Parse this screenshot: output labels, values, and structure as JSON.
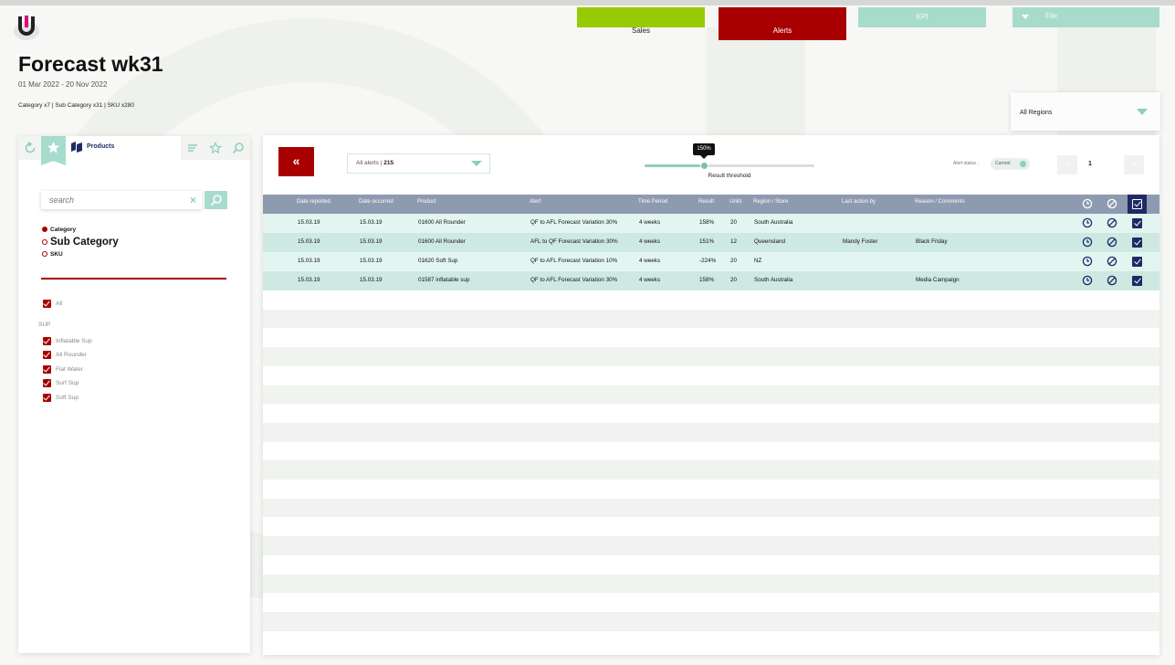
{
  "page": {
    "title": "Forecast wk31",
    "date_range": "01 Mar 2022 - 20 Nov 2022",
    "counts": "Category x7  |  Sub Category x31  |  SKU x280"
  },
  "top_tabs": {
    "sales": "Sales",
    "alerts": "Alerts",
    "kpi": "KPI",
    "file": "File"
  },
  "region": {
    "selected": "All Regions"
  },
  "sidebar": {
    "products_tab": "Products",
    "search_placeholder": "search",
    "levels": [
      "Category",
      "Sub Category",
      "SKU"
    ],
    "all_label": "All",
    "group_label": "SUP",
    "items": [
      "Inflatable Sup",
      "All Rounder",
      "Flat Water",
      "Surf Sup",
      "Soft Sup"
    ]
  },
  "toolbar": {
    "back_label": "«",
    "alerts_filter_label": "All alerts",
    "alerts_filter_sep": " | ",
    "alerts_filter_count": "215",
    "threshold_value": "150%",
    "threshold_fraction": 0.35,
    "threshold_label": "Result threshold",
    "alert_status_label": "Alert status :",
    "alert_status_value": "Current",
    "page_number": "1",
    "prev_label": "‹",
    "next_label": "›"
  },
  "table": {
    "columns": [
      "Date reported",
      "Date occurred",
      "Product",
      "Alert",
      "Time Period",
      "Result",
      "Units",
      "Region / Store",
      "Last action by",
      "Reason / Comments"
    ],
    "rows": [
      {
        "date_reported": "15.03.19",
        "date_occurred": "15.03.19",
        "product": "01600 All Rounder",
        "alert": "QF to AFL Forecast Variation 30%",
        "period": "4 weeks",
        "result": "158%",
        "units": "20",
        "region": "South Australia",
        "last_action": "",
        "reason": ""
      },
      {
        "date_reported": "15.03.19",
        "date_occurred": "15.03.19",
        "product": "01600 All Rounder",
        "alert": "AFL to QF Forecast Variation 30%",
        "period": "4 weeks",
        "result": "151%",
        "units": "12",
        "region": "Queensland",
        "last_action": "Mandy Foster",
        "reason": "Black Friday"
      },
      {
        "date_reported": "15.03.19",
        "date_occurred": "15.03.19",
        "product": "01620 Soft Sup",
        "alert": "QF to AFL Forecast Variation 10%",
        "period": "4 weeks",
        "result": "-224%",
        "units": "20",
        "region": "NZ",
        "last_action": "",
        "reason": ""
      },
      {
        "date_reported": "15.03.19",
        "date_occurred": "15.03.19",
        "product": "01587 inflatable sup",
        "alert": "QF to AFL Forecast Variation 30%",
        "period": "4 weeks",
        "result": "158%",
        "units": "20",
        "region": "South Australia",
        "last_action": "",
        "reason": "Media Campaign"
      }
    ]
  },
  "colors": {
    "accent_red": "#a80000",
    "accent_mint": "#a7dccd",
    "accent_green": "#95cb00",
    "navy": "#1e2a66",
    "header_gray": "#8e9aaf"
  }
}
